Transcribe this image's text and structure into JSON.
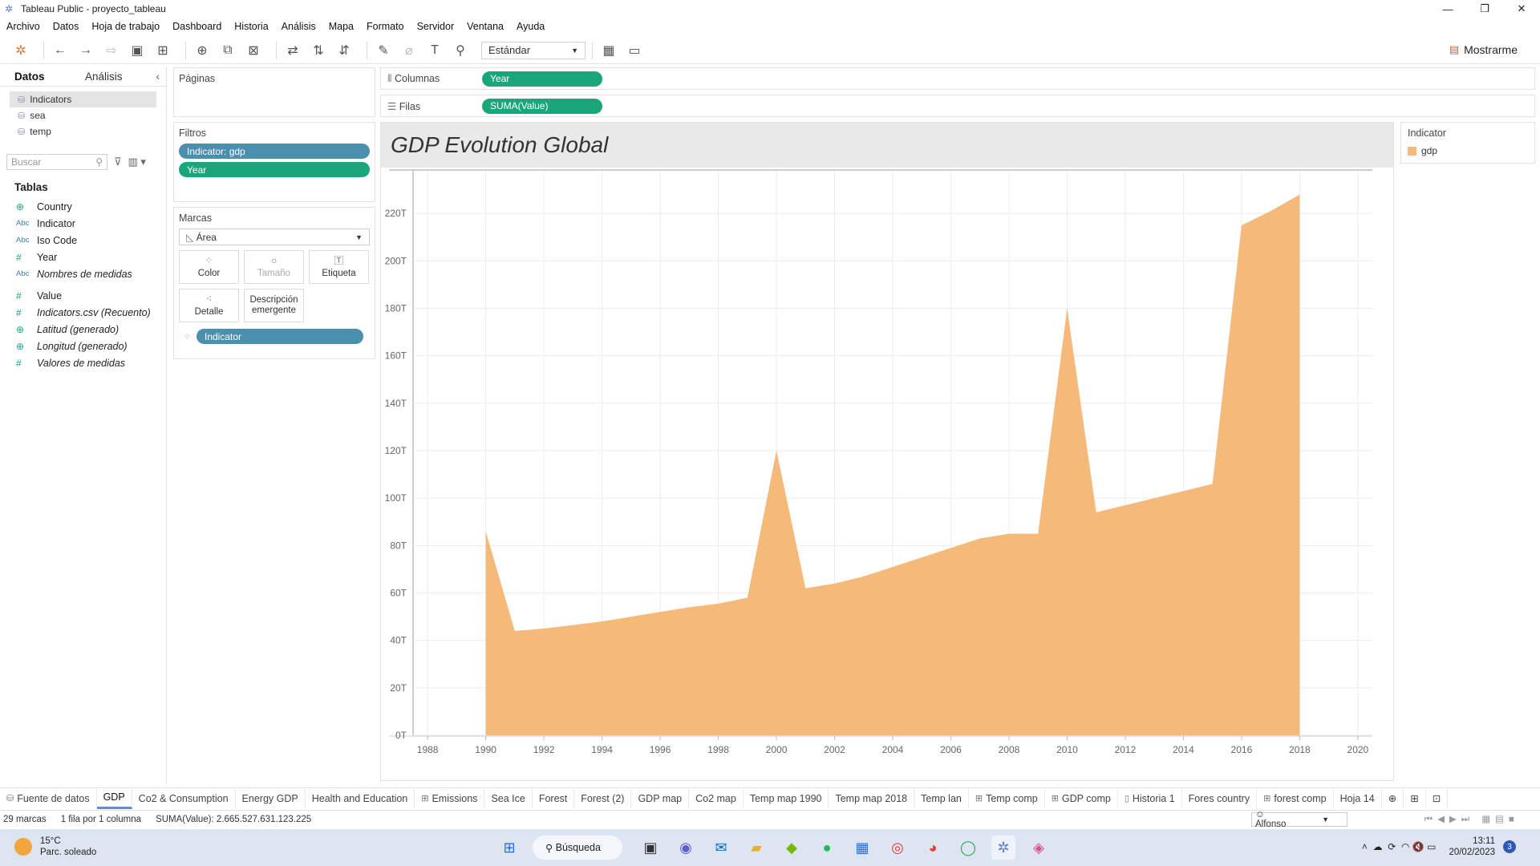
{
  "window": {
    "title": "Tableau Public - proyecto_tableau"
  },
  "menu": [
    "Archivo",
    "Datos",
    "Hoja de trabajo",
    "Dashboard",
    "Historia",
    "Análisis",
    "Mapa",
    "Formato",
    "Servidor",
    "Ventana",
    "Ayuda"
  ],
  "toolbar": {
    "fit_select": "Estándar",
    "show_me": "Mostrarme"
  },
  "data_pane": {
    "tab_data": "Datos",
    "tab_analysis": "Análisis",
    "sources": [
      "Indicators",
      "sea",
      "temp"
    ],
    "search_placeholder": "Buscar",
    "tables_header": "Tablas",
    "fields": [
      {
        "type": "geo",
        "name": "Country"
      },
      {
        "type": "Abc",
        "name": "Indicator"
      },
      {
        "type": "Abc",
        "name": "Iso Code"
      },
      {
        "type": "#",
        "name": "Year"
      },
      {
        "type": "Abc",
        "name": "Nombres de medidas"
      },
      {
        "type": "#",
        "name": "Value"
      },
      {
        "type": "#",
        "name": "Indicators.csv (Recuento)"
      },
      {
        "type": "geo",
        "name": "Latitud (generado)"
      },
      {
        "type": "geo",
        "name": "Longitud (generado)"
      },
      {
        "type": "#",
        "name": "Valores de medidas"
      }
    ]
  },
  "cards": {
    "pages": "Páginas",
    "filters": "Filtros",
    "filter_pills": [
      "Indicator: gdp",
      "Year"
    ],
    "marks": "Marcas",
    "mark_type": "Área",
    "mark_buttons": [
      "Color",
      "Tamaño",
      "Etiqueta",
      "Detalle",
      "Descripción emergente"
    ],
    "mark_pill": "Indicator"
  },
  "shelves": {
    "columns_label": "Columnas",
    "columns_pill": "Year",
    "rows_label": "Filas",
    "rows_pill": "SUMA(Value)"
  },
  "view": {
    "title": "GDP Evolution Global"
  },
  "legend": {
    "title": "Indicator",
    "item": "gdp",
    "color": "#f5b97a"
  },
  "chart_data": {
    "type": "area",
    "title": "GDP Evolution Global",
    "xlabel": "",
    "ylabel": "",
    "x": [
      1990,
      1991,
      1992,
      1993,
      1994,
      1995,
      1996,
      1997,
      1998,
      1999,
      2000,
      2001,
      2002,
      2003,
      2004,
      2005,
      2006,
      2007,
      2008,
      2009,
      2010,
      2011,
      2012,
      2013,
      2014,
      2015,
      2016,
      2017,
      2018
    ],
    "series": [
      {
        "name": "gdp",
        "values": [
          86,
          44,
          45,
          46.5,
          48,
          50,
          52,
          54,
          55.5,
          58,
          120,
          62,
          64,
          67,
          71,
          75,
          79,
          83,
          85,
          85,
          180,
          94,
          97,
          100,
          103,
          106,
          215,
          221,
          228
        ]
      }
    ],
    "x_ticks": [
      1988,
      1990,
      1992,
      1994,
      1996,
      1998,
      2000,
      2002,
      2004,
      2006,
      2008,
      2010,
      2012,
      2014,
      2016,
      2018,
      2020
    ],
    "y_ticks": [
      "0T",
      "20T",
      "40T",
      "60T",
      "80T",
      "100T",
      "120T",
      "140T",
      "160T",
      "180T",
      "200T",
      "220T"
    ],
    "xlim": [
      1987.5,
      2020.5
    ],
    "ylim": [
      0,
      238
    ],
    "grid": true,
    "legend": "right"
  },
  "sheets": [
    "Fuente de datos",
    "GDP",
    "Co2 & Consumption",
    "Energy GDP",
    "Health and Education",
    "Emissions",
    "Sea Ice",
    "Forest",
    "Forest (2)",
    "GDP map",
    "Co2 map",
    "Temp map 1990",
    "Temp map 2018",
    "Temp lan",
    "Temp comp",
    "GDP comp",
    "Historia 1",
    "Fores country",
    "forest comp",
    "Hoja 14"
  ],
  "status": {
    "marks": "29 marcas",
    "dims": "1 fila por 1 columna",
    "sum": "SUMA(Value): 2.665.527.631.123.225",
    "user": "Alfonso"
  },
  "taskbar": {
    "temp": "15°C",
    "weather": "Parc. soleado",
    "search": "Búsqueda",
    "time": "13:11",
    "date": "20/02/2023",
    "notifications": "3"
  }
}
